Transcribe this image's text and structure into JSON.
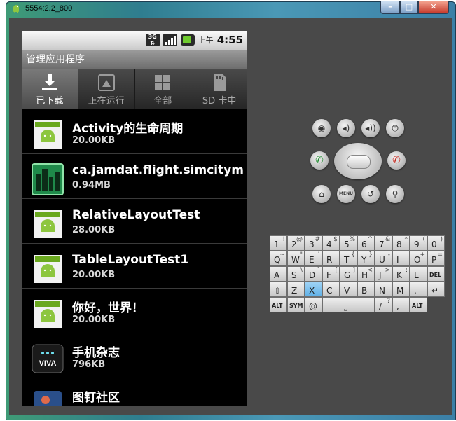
{
  "window": {
    "title": "5554:2.2_800",
    "min_label": "–",
    "max_label": "□",
    "close_label": "✕"
  },
  "status": {
    "network": "3G",
    "ampm": "上午",
    "time": "4:55"
  },
  "app_title": "管理应用程序",
  "tabs": [
    {
      "label": "已下载",
      "icon": "download-icon",
      "active": true
    },
    {
      "label": "正在运行",
      "icon": "running-icon",
      "active": false
    },
    {
      "label": "全部",
      "icon": "grid-icon",
      "active": false
    },
    {
      "label": "SD 卡中",
      "icon": "sdcard-icon",
      "active": false
    }
  ],
  "apps": [
    {
      "name": "Activity的生命周期",
      "size": "20.00KB",
      "icon": "android-app-icon"
    },
    {
      "name": "ca.jamdat.flight.simcitymet",
      "size": "0.94MB",
      "icon": "simcity-icon"
    },
    {
      "name": "RelativeLayoutTest",
      "size": "28.00KB",
      "icon": "android-app-icon"
    },
    {
      "name": "TableLayoutTest1",
      "size": "20.00KB",
      "icon": "android-app-icon"
    },
    {
      "name": "你好，世界！",
      "size": "20.00KB",
      "icon": "android-app-icon"
    },
    {
      "name": "手机杂志",
      "size": "796KB",
      "icon": "viva-icon"
    },
    {
      "name": "图钉社区",
      "size": "",
      "icon": "community-icon"
    }
  ],
  "controls": {
    "menu_label": "MENU"
  },
  "keyboard": {
    "row1": [
      [
        "1",
        "!"
      ],
      [
        "2",
        "@"
      ],
      [
        "3",
        "#"
      ],
      [
        "4",
        "$"
      ],
      [
        "5",
        "%"
      ],
      [
        "6",
        "^"
      ],
      [
        "7",
        "&"
      ],
      [
        "8",
        "*"
      ],
      [
        "9",
        "("
      ],
      [
        "0",
        ")"
      ]
    ],
    "row2": [
      [
        "Q",
        "~"
      ],
      [
        "W",
        "\""
      ],
      [
        "E",
        "´"
      ],
      [
        "R",
        ""
      ],
      [
        "T",
        "{"
      ],
      [
        "Y",
        "}"
      ],
      [
        "U",
        "-"
      ],
      [
        "I",
        ""
      ],
      [
        "O",
        "+"
      ],
      [
        "P",
        "="
      ]
    ],
    "row3": [
      [
        "A",
        ""
      ],
      [
        "S",
        "\\"
      ],
      [
        "D",
        "`"
      ],
      [
        "F",
        "["
      ],
      [
        "G",
        "]"
      ],
      [
        "H",
        "<"
      ],
      [
        "J",
        ">"
      ],
      [
        "K",
        ";"
      ],
      [
        "L",
        ":"
      ],
      [
        "DEL",
        ""
      ]
    ],
    "row4": [
      [
        "⇧",
        ""
      ],
      [
        "Z",
        ""
      ],
      [
        "X",
        ""
      ],
      [
        "C",
        ""
      ],
      [
        "V",
        ""
      ],
      [
        "B",
        ""
      ],
      [
        "N",
        ""
      ],
      [
        "M",
        ""
      ],
      [
        ".",
        ""
      ],
      [
        "↵",
        ""
      ]
    ],
    "row5": [
      [
        "ALT",
        ""
      ],
      [
        "SYM",
        ""
      ],
      [
        "@",
        ""
      ],
      [
        "",
        ""
      ],
      [
        "/",
        "?"
      ],
      [
        ",",
        ""
      ],
      [
        "ALT",
        ""
      ]
    ],
    "space_label": "⎵",
    "selected_key": "X"
  }
}
